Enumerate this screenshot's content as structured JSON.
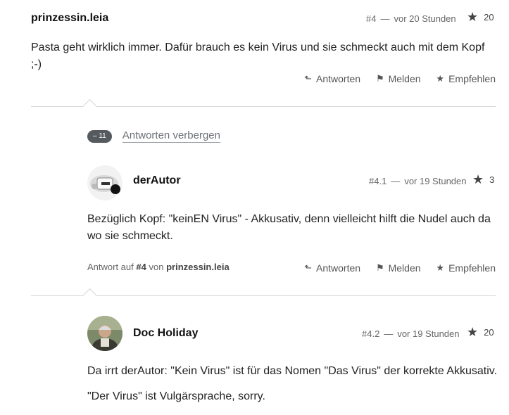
{
  "comment1": {
    "username": "prinzessin.leia",
    "number": "#4",
    "time": "vor 20 Stunden",
    "stars": "20",
    "text": "Pasta geht wirklich immer. Dafür brauch es kein Virus und sie schmeckt auch mit dem Kopf ;-)"
  },
  "actions": {
    "reply": "Antworten",
    "report": "Melden",
    "recommend": "Empfehlen"
  },
  "replies_toggle": {
    "count": "– 11",
    "label": "Antworten verbergen"
  },
  "reply1": {
    "username": "derAutor",
    "number": "#4.1",
    "time": "vor 19 Stunden",
    "stars": "3",
    "text": "Bezüglich Kopf: \"keinEN Virus\" - Akkusativ, denn vielleicht hilft die Nudel auch da wo sie schmeckt.",
    "reply_to_prefix": "Antwort auf",
    "reply_to_number": "#4",
    "reply_to_from": "von",
    "reply_to_user": "prinzessin.leia"
  },
  "reply2": {
    "username": "Doc Holiday",
    "number": "#4.2",
    "time": "vor 19 Stunden",
    "stars": "20",
    "text1": "Da irrt derAutor: \"Kein Virus\" ist für das Nomen \"Das Virus\" der korrekte Akkusativ.",
    "text2": "\"Der Virus\" ist Vulgärsprache, sorry."
  },
  "meta_separator": "—",
  "icons": {
    "star": "star-icon",
    "reply": "reply-arrow-icon",
    "report": "flag-icon",
    "recommend": "star-icon"
  }
}
